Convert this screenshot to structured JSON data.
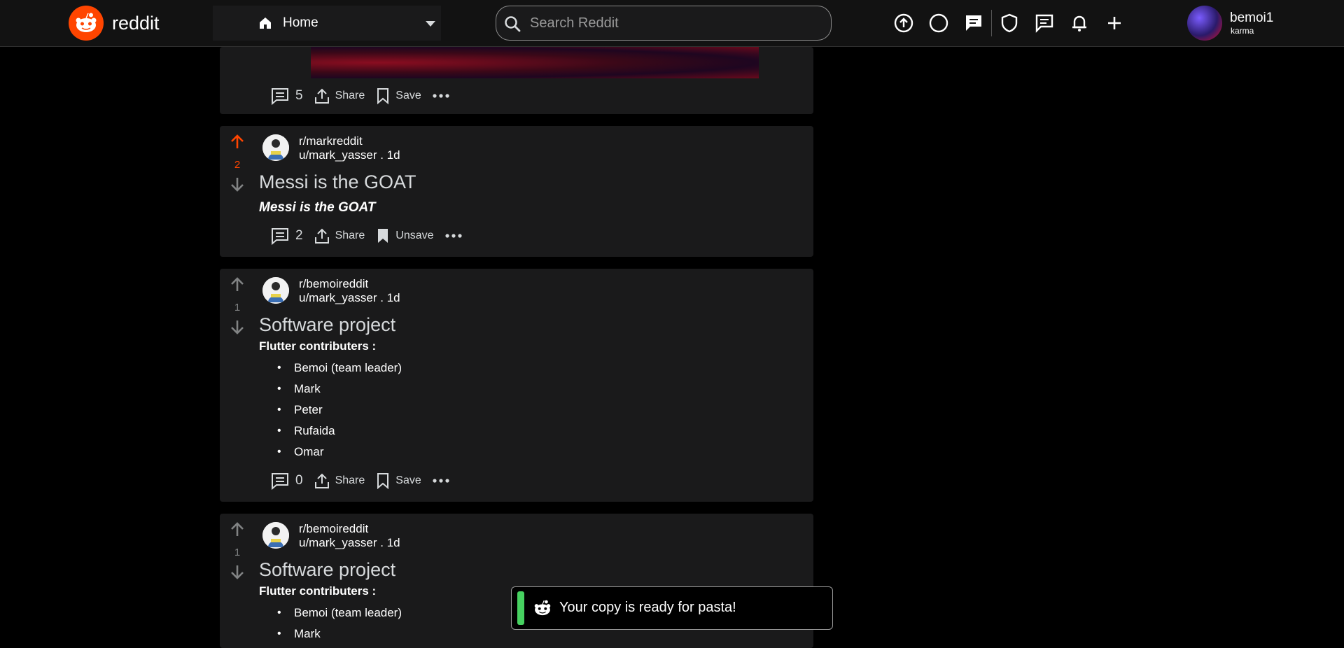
{
  "header": {
    "logo_text": "reddit",
    "home_label": "Home",
    "search_placeholder": "Search Reddit",
    "user_name": "bemoi1",
    "user_karma": "karma",
    "accent_color": "#ff4500",
    "icons": [
      "arrow-up-circle-icon",
      "circle-icon",
      "chat-icon",
      "shield-icon",
      "message-icon",
      "bell-icon",
      "plus-icon"
    ]
  },
  "posts": [
    {
      "actions": {
        "comments": "5",
        "share": "Share",
        "save": "Save"
      }
    },
    {
      "subreddit": "r/markreddit",
      "meta": "u/mark_yasser . 1d",
      "votes": "2",
      "upvoted": true,
      "title": "Messi is the GOAT",
      "body": "Messi is the GOAT",
      "actions": {
        "comments": "2",
        "share": "Share",
        "save": "Unsave"
      }
    },
    {
      "subreddit": "r/bemoireddit",
      "meta": "u/mark_yasser . 1d",
      "votes": "1",
      "title": "Software project",
      "body_heading": "Flutter contributers :",
      "items": [
        "Bemoi (team leader)",
        "Mark",
        "Peter",
        "Rufaida",
        "Omar"
      ],
      "actions": {
        "comments": "0",
        "share": "Share",
        "save": "Save"
      }
    },
    {
      "subreddit": "r/bemoireddit",
      "meta": "u/mark_yasser . 1d",
      "votes": "1",
      "title": "Software project",
      "body_heading": "Flutter contributers :",
      "items": [
        "Bemoi (team leader)",
        "Mark"
      ]
    }
  ],
  "toast": {
    "message": "Your copy is ready for pasta!",
    "status_color": "#46d160"
  }
}
